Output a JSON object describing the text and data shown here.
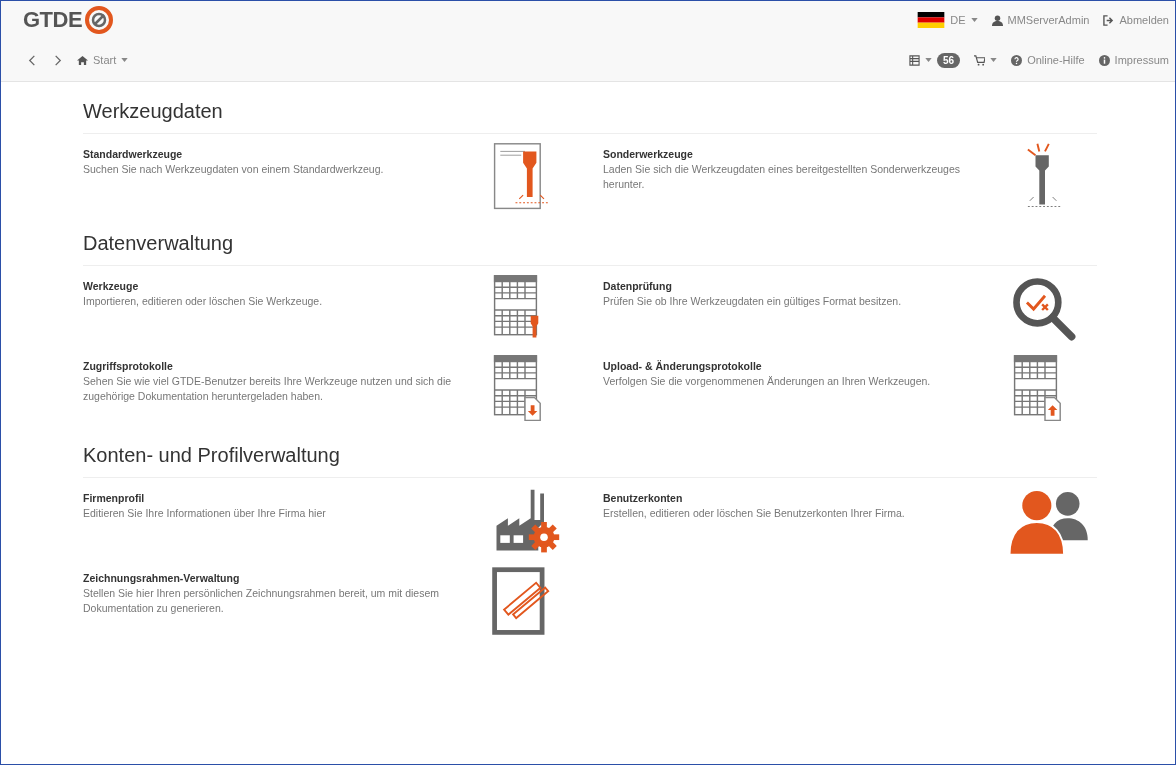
{
  "header": {
    "logo": "GTDE",
    "language": "DE",
    "user": "MMServerAdmin",
    "logout": "Abmelden",
    "start": "Start",
    "badge": "56",
    "links": [
      {
        "kind": "help",
        "label": "Online-Hilfe"
      },
      {
        "kind": "info",
        "label": "Impressum"
      }
    ]
  },
  "sections": [
    {
      "title": "Werkzeugdaten",
      "items": [
        {
          "kind": "drawing-tool",
          "title": "Standardwerkzeuge",
          "text": "Suchen Sie nach Werkzeugdaten von einem Standardwerkzeug."
        },
        {
          "kind": "special-tool",
          "title": "Sonderwerkzeuge",
          "text": "Laden Sie sich die Werkzeugdaten eines bereitgestellten Sonderwerkzeuges herunter."
        }
      ]
    },
    {
      "title": "Datenverwaltung",
      "items": [
        {
          "kind": "table-tool",
          "title": "Werkzeuge",
          "text": "Importieren, editieren oder löschen Sie Werkzeuge."
        },
        {
          "kind": "magnifier",
          "title": "Datenprüfung",
          "text": "Prüfen Sie ob Ihre Werkzeugdaten ein gültiges Format besitzen."
        },
        {
          "kind": "table-download",
          "title": "Zugriffsprotokolle",
          "text": "Sehen Sie wie viel GTDE-Benutzer bereits Ihre Werkzeuge nutzen und sich die zugehörige Dokumentation heruntergeladen haben."
        },
        {
          "kind": "table-upload",
          "title": "Upload- & Änderungsprotokolle",
          "text": "Verfolgen Sie die vorgenommenen Änderungen an Ihren Werkzeugen."
        }
      ]
    },
    {
      "title": "Konten- und Profilverwaltung",
      "items": [
        {
          "kind": "factory",
          "title": "Firmenprofil",
          "text": "Editieren Sie Ihre Informationen über Ihre Firma hier"
        },
        {
          "kind": "users",
          "title": "Benutzerkonten",
          "text": "Erstellen, editieren oder löschen Sie Benutzerkonten Ihrer Firma."
        },
        {
          "kind": "frame-pencil",
          "title": "Zeichnungsrahmen-Verwaltung",
          "text": "Stellen Sie hier Ihren persönlichen Zeichnungsrahmen bereit, um mit diesem Dokumentation zu generieren."
        }
      ]
    }
  ]
}
